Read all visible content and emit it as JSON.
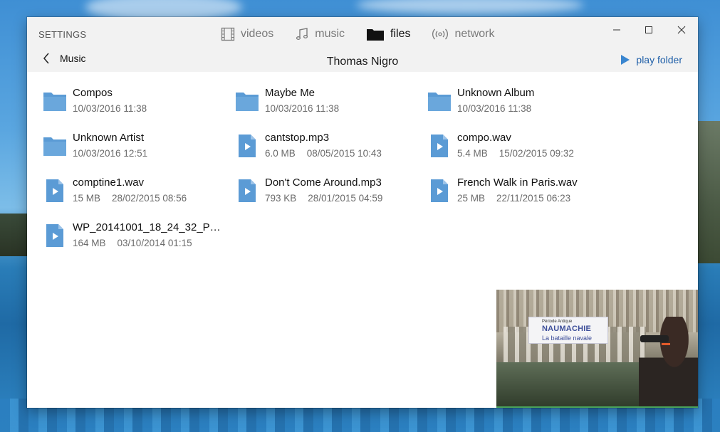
{
  "header": {
    "settings_label": "SETTINGS",
    "tabs": [
      {
        "label": "videos",
        "icon": "film-icon"
      },
      {
        "label": "music",
        "icon": "music-note-icon"
      },
      {
        "label": "files",
        "icon": "folder-icon"
      },
      {
        "label": "network",
        "icon": "network-broadcast-icon"
      }
    ],
    "active_tab": "files"
  },
  "toolbar": {
    "back_label": "Music",
    "folder_title": "Thomas Nigro",
    "play_label": "play folder"
  },
  "items": [
    {
      "type": "folder",
      "name": "Compos",
      "size": "",
      "date": "10/03/2016 11:38"
    },
    {
      "type": "folder",
      "name": "Maybe Me",
      "size": "",
      "date": "10/03/2016 11:38"
    },
    {
      "type": "folder",
      "name": "Unknown Album",
      "size": "",
      "date": "10/03/2016 11:38"
    },
    {
      "type": "folder",
      "name": "Unknown Artist",
      "size": "",
      "date": "10/03/2016 12:51"
    },
    {
      "type": "file",
      "name": "cantstop.mp3",
      "size": "6.0 MB",
      "date": "08/05/2015 10:43"
    },
    {
      "type": "file",
      "name": "compo.wav",
      "size": "5.4 MB",
      "date": "15/02/2015 09:32"
    },
    {
      "type": "file",
      "name": "comptine1.wav",
      "size": "15 MB",
      "date": "28/02/2015 08:56"
    },
    {
      "type": "file",
      "name": "Don't Come Around.mp3",
      "size": "793 KB",
      "date": "28/01/2015 04:59"
    },
    {
      "type": "file",
      "name": "French Walk in Paris.wav",
      "size": "25 MB",
      "date": "22/11/2015 06:23"
    },
    {
      "type": "file",
      "name": "WP_20141001_18_24_32_Pro....",
      "size": "164 MB",
      "date": "03/10/2014 01:15"
    }
  ],
  "video_preview": {
    "sign_small": "Période Antique",
    "sign_title": "NAUMACHIE",
    "sign_subtitle": "La bataille navale"
  },
  "colors": {
    "accent": "#1f5fa8",
    "folder": "#5b9bd5",
    "header_bg": "#f2f2f2"
  }
}
